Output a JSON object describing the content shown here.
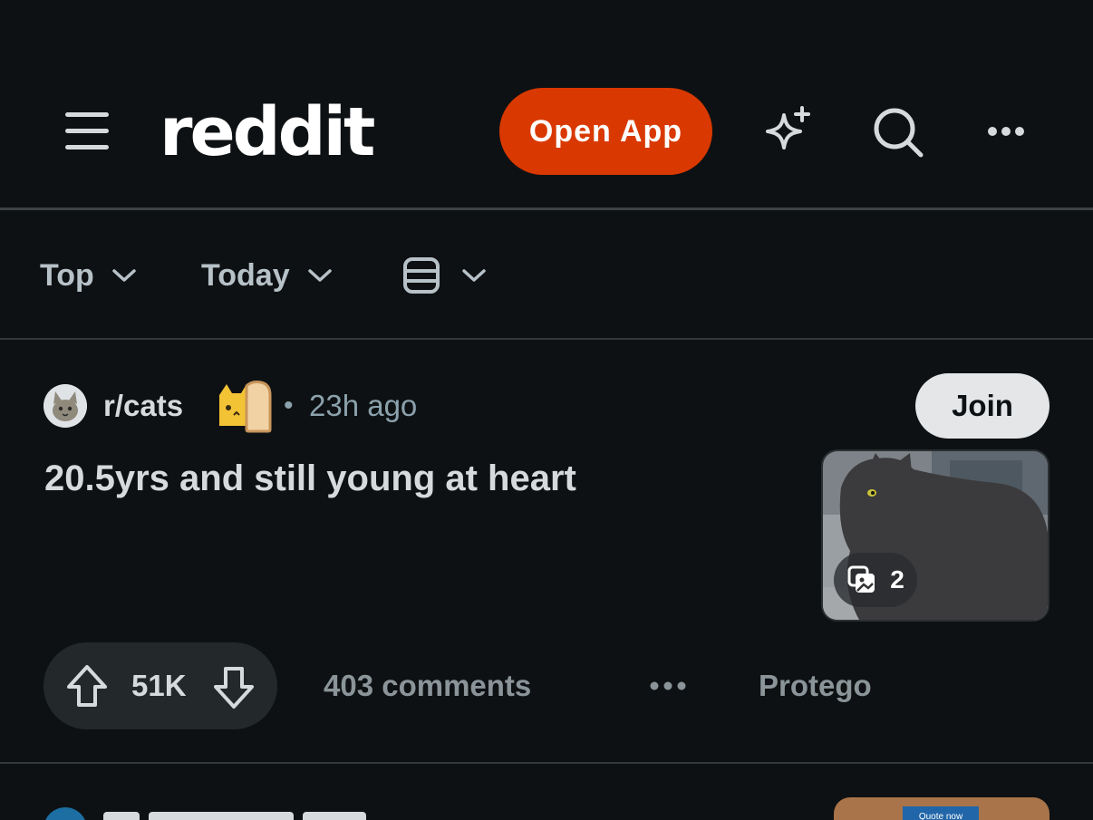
{
  "header": {
    "logo_text": "reddit",
    "open_app_label": "Open App",
    "accent_color": "#d93900",
    "icons": [
      "menu-icon",
      "sparkle-icon",
      "search-icon",
      "more-icon"
    ]
  },
  "sort_bar": {
    "sort_label": "Top",
    "time_label": "Today",
    "view_icon": "card-view-icon"
  },
  "post": {
    "subreddit": "r/cats",
    "separator": "•",
    "time": "23h ago",
    "join_label": "Join",
    "title": "20.5yrs and still young at heart",
    "gallery_count": "2",
    "score": "51K",
    "comments": "403 comments",
    "award_label": "Protego"
  },
  "next_post": {
    "quote_button": "Quote now"
  }
}
